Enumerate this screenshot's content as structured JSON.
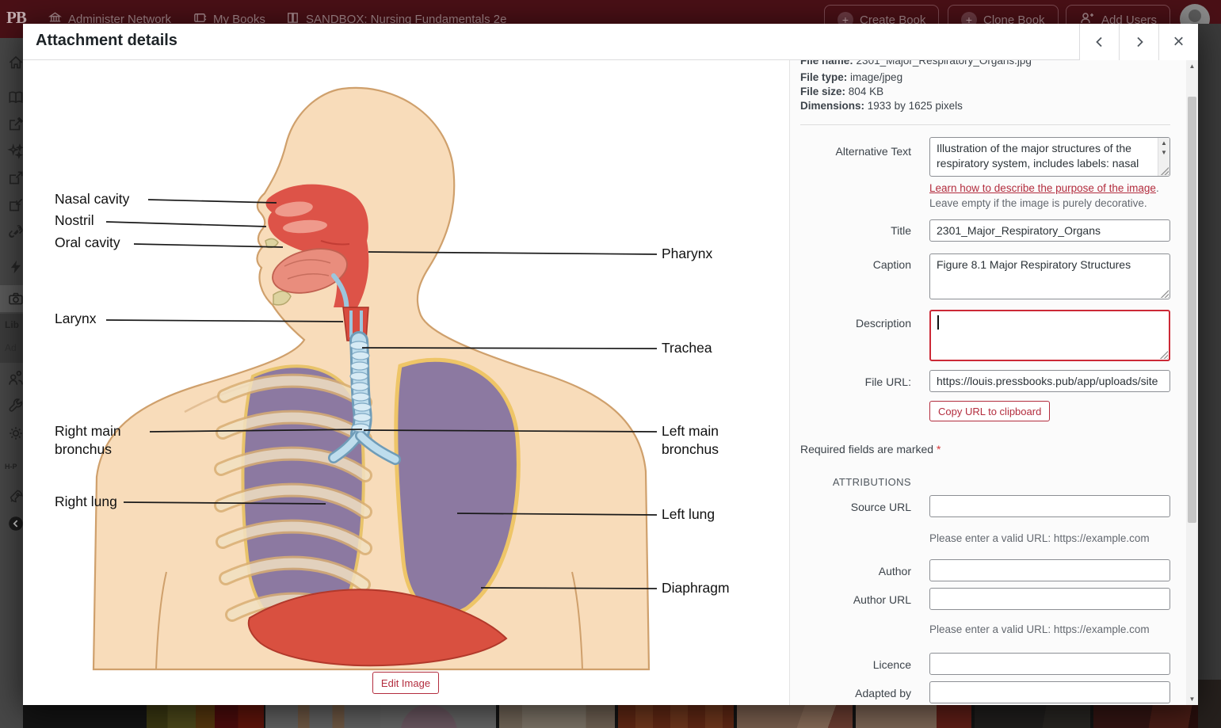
{
  "colors": {
    "topbar": "#4a1016",
    "accent_red": "#b32d3e",
    "focus_red": "#cc2936",
    "lung_purple": "#8c79a1",
    "skin": "#f8dcba"
  },
  "topbar": {
    "logo": "PB",
    "nav": {
      "administer_network": "Administer Network",
      "my_books": "My Books",
      "current_book": "SANDBOX: Nursing Fundamentals 2e"
    },
    "actions": {
      "create_book": "Create Book",
      "clone_book": "Clone Book",
      "add_users": "Add Users"
    },
    "plus_glyph": "+"
  },
  "sidebar": {
    "library_label": "Lib",
    "admin_label": "Ad",
    "hp_label": "H-P"
  },
  "modal": {
    "title": "Attachment details",
    "close_glyph": "×",
    "meta": {
      "file_name_label": "File name:",
      "file_name": "2301_Major_Respiratory_Organs.jpg",
      "file_type_label": "File type:",
      "file_type": "image/jpeg",
      "file_size_label": "File size:",
      "file_size": "804 KB",
      "dimensions_label": "Dimensions:",
      "dimensions": "1933 by 1625 pixels"
    },
    "alt": {
      "label": "Alternative Text",
      "value": "Illustration of the major structures of the respiratory system, includes labels: nasal",
      "help_link": "Learn how to describe the purpose of the image",
      "help_rest": ". Leave empty if the image is purely decorative."
    },
    "title_field": {
      "label": "Title",
      "value": "2301_Major_Respiratory_Organs"
    },
    "caption_field": {
      "label": "Caption",
      "value": "Figure 8.1 Major Respiratory Structures"
    },
    "description_field": {
      "label": "Description",
      "value": ""
    },
    "file_url_field": {
      "label": "File URL:",
      "value": "https://louis.pressbooks.pub/app/uploads/site"
    },
    "copy_button": "Copy URL to clipboard",
    "required_note": "Required fields are marked",
    "required_star": "*",
    "attributions_heading": "ATTRIBUTIONS",
    "attribution_fields": {
      "source_url": "Source URL",
      "author": "Author",
      "author_url": "Author URL",
      "licence": "Licence",
      "adapted_by": "Adapted by"
    },
    "url_helper": "Please enter a valid URL: https://example.com",
    "edit_image_button": "Edit Image"
  },
  "illustration": {
    "labels": {
      "nasal_cavity": "Nasal cavity",
      "nostril": "Nostril",
      "oral_cavity": "Oral cavity",
      "larynx": "Larynx",
      "right_main_1": "Right main",
      "right_main_2": "bronchus",
      "right_lung": "Right lung",
      "pharynx": "Pharynx",
      "trachea": "Trachea",
      "left_main_1": "Left main",
      "left_main_2": "bronchus",
      "left_lung": "Left lung",
      "diaphragm": "Diaphragm"
    }
  }
}
